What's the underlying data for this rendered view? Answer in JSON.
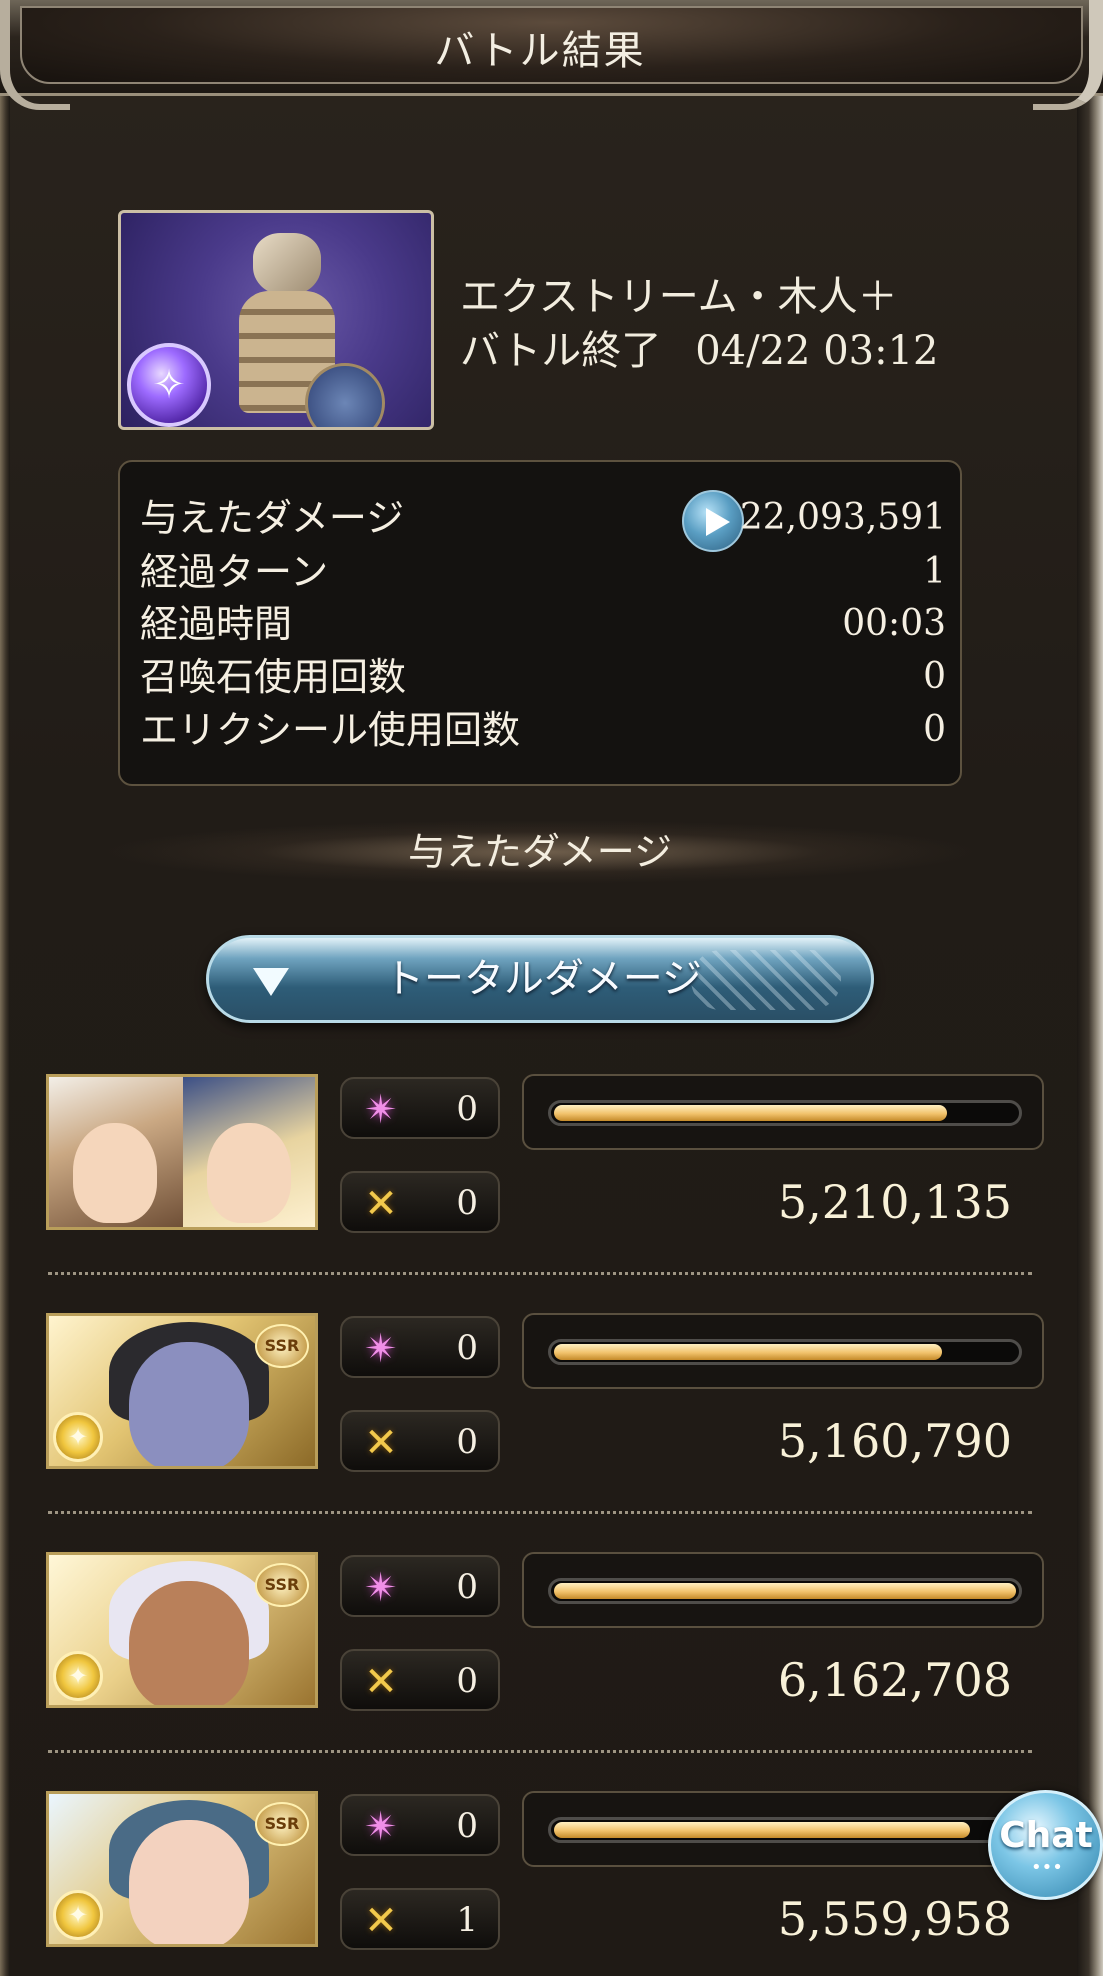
{
  "header": {
    "title": "バトル結果"
  },
  "quest": {
    "name": "エクストリーム・木人＋",
    "end_label": "バトル終了",
    "end_datetime": "04/22 03:12",
    "element_icon": "wind-element-icon"
  },
  "stats": [
    {
      "label": "与えたダメージ",
      "value": "22,093,591"
    },
    {
      "label": "経過ターン",
      "value": "1"
    },
    {
      "label": "経過時間",
      "value": "00:03"
    },
    {
      "label": "召喚石使用回数",
      "value": "0"
    },
    {
      "label": "エリクシール使用回数",
      "value": "0"
    }
  ],
  "section": {
    "title": "与えたダメージ"
  },
  "dropdown": {
    "label": "トータルダメージ"
  },
  "characters": [
    {
      "ougi_count": "0",
      "chain_count": "0",
      "damage": "5,210,135",
      "bar_fraction": 0.85,
      "portrait": "main-character-portrait",
      "rarity": ""
    },
    {
      "ougi_count": "0",
      "chain_count": "0",
      "damage": "5,160,790",
      "bar_fraction": 0.84,
      "portrait": "ssr-character-portrait",
      "rarity": "SSR"
    },
    {
      "ougi_count": "0",
      "chain_count": "0",
      "damage": "6,162,708",
      "bar_fraction": 1.0,
      "portrait": "ssr-character-portrait",
      "rarity": "SSR"
    },
    {
      "ougi_count": "0",
      "chain_count": "1",
      "damage": "5,559,958",
      "bar_fraction": 0.9,
      "portrait": "ssr-character-portrait",
      "rarity": "SSR"
    }
  ],
  "chat": {
    "label": "Chat"
  },
  "colors": {
    "bar_fill": "#f1c26b",
    "accent_blue": "#5a9ec3",
    "background": "#211c17"
  }
}
